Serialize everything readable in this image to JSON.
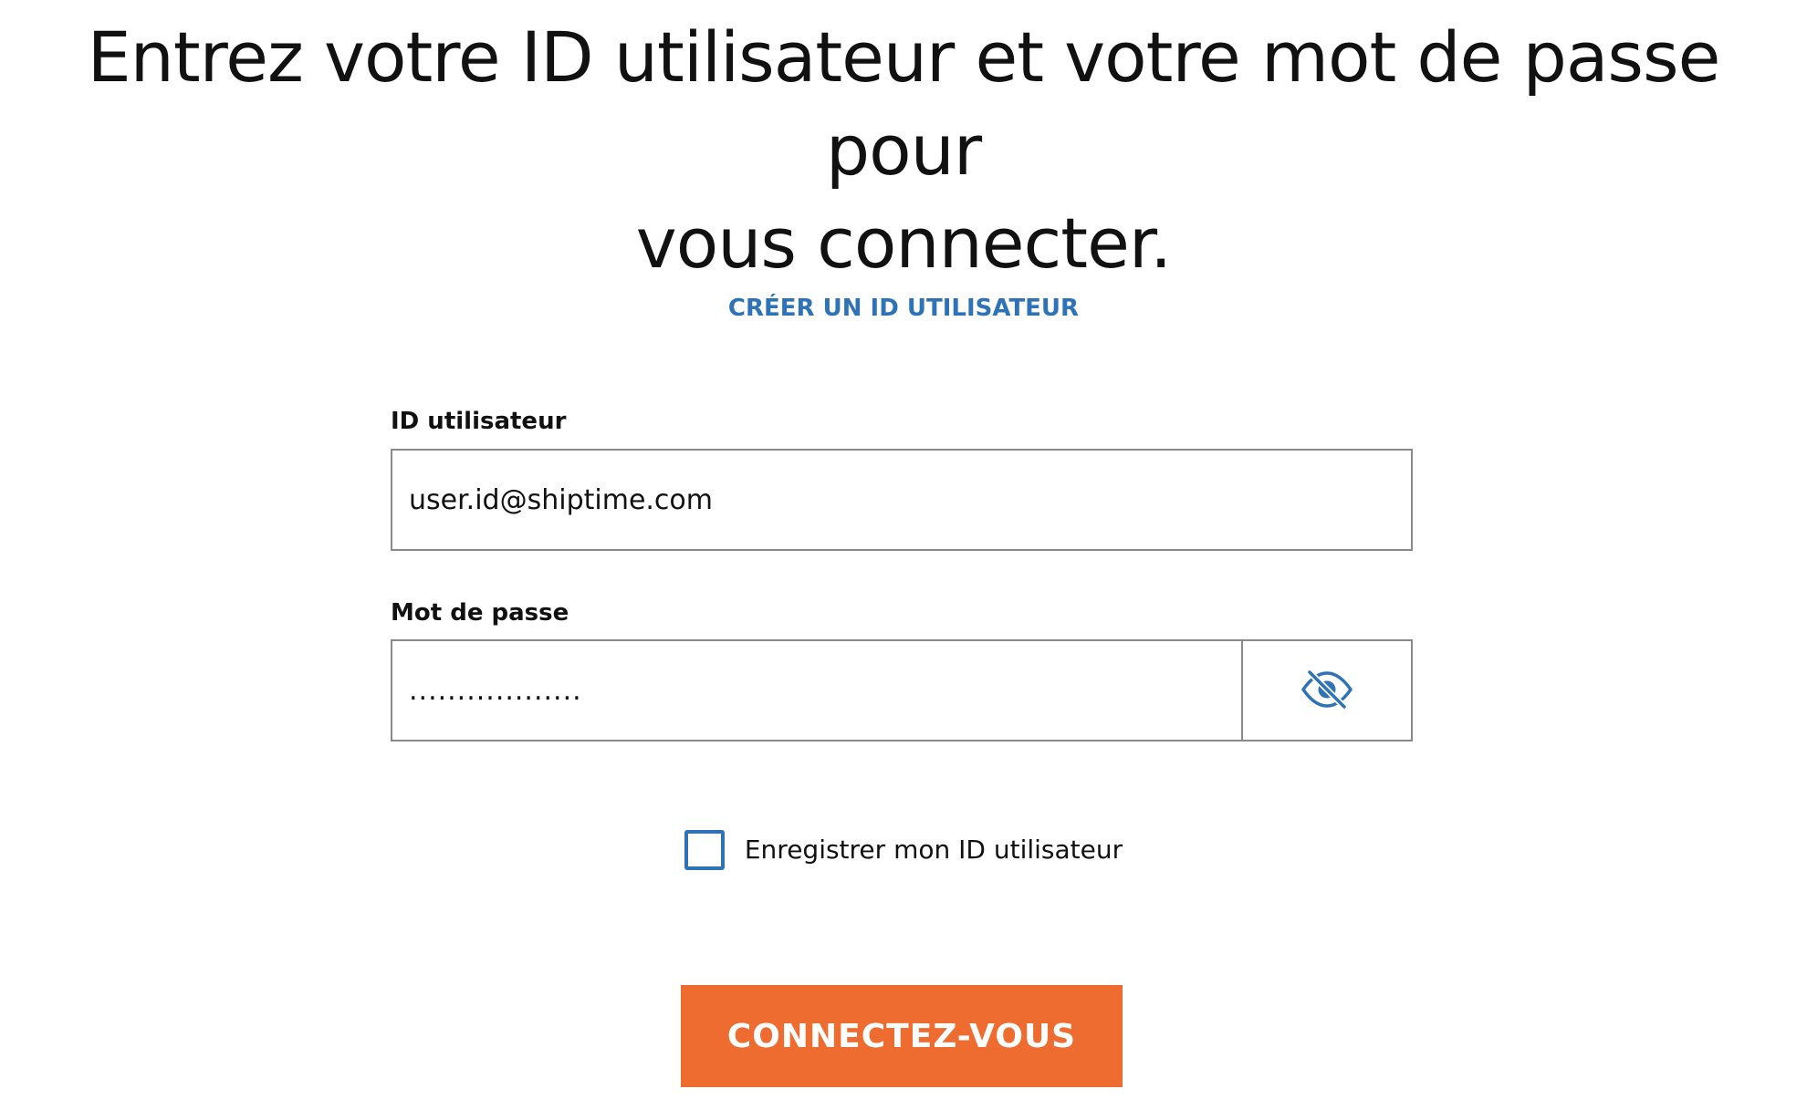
{
  "header": {
    "title_line1": "Entrez votre ID utilisateur et votre mot de passe pour",
    "title_line2": "vous connecter."
  },
  "links": {
    "create_user_id": "CRÉER UN ID UTILISATEUR"
  },
  "form": {
    "user_id": {
      "label": "ID utilisateur",
      "value": "user.id@shiptime.com"
    },
    "password": {
      "label": "Mot de passe",
      "value": "..................",
      "toggle_icon": "eye-slash-icon"
    },
    "remember": {
      "label": "Enregistrer mon ID utilisateur",
      "checked": false
    },
    "submit_label": "CONNECTEZ-VOUS"
  },
  "colors": {
    "accent_blue": "#2e72b8",
    "button_orange": "#ee6c2f",
    "border_gray": "#8a8a8a",
    "text": "#111111"
  }
}
